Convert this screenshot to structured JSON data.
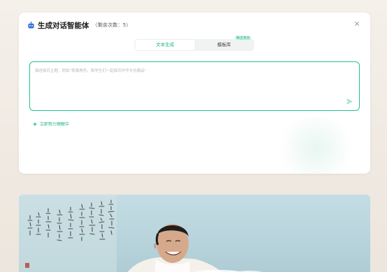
{
  "dialog": {
    "title": "生成对话智能体",
    "remaining": "（剩余次数：5）"
  },
  "tabs": [
    {
      "label": "文本生成",
      "active": true
    },
    {
      "label": "模板库",
      "active": false,
      "badge": "精选角色"
    }
  ],
  "prompt": {
    "placeholder": "描述探究主题，例如“叙事角色、和学生们一起探究中华文化精品”",
    "value": ""
  },
  "hint": {
    "label": "立即努力理解中"
  },
  "colors": {
    "accent": "#22c58b",
    "accent_text": "#1ab87e",
    "bot_icon": "#3b6fe0"
  },
  "icons": {
    "bot": "robot-icon",
    "close": "close-icon",
    "send": "send-icon",
    "sparkle": "sparkle-icon"
  }
}
